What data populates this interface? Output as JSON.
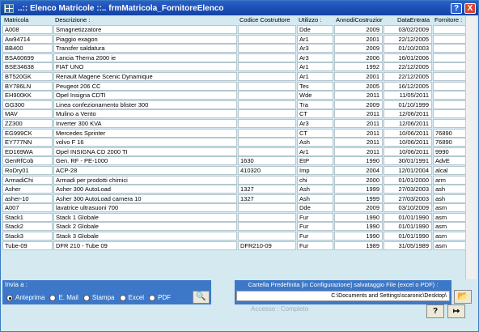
{
  "window": {
    "title": "..:: Elenco Matricole ::..   frmMatricola_FornitoreElenco",
    "help_glyph": "?",
    "close_glyph": "X"
  },
  "columns": [
    "Matricola",
    "Descrizione :",
    "Codice Costruttore",
    "Utilizzo :",
    "AnnodiCostruzione",
    "DataEntrata",
    "Fornitore :"
  ],
  "rows": [
    [
      "A008",
      "Smagnetizzatore",
      "",
      "Dde",
      "2009",
      "03/02/2009",
      ""
    ],
    [
      "Aw94714",
      "Piaggio exagon",
      "",
      "Ar1",
      "2001",
      "22/12/2005",
      ""
    ],
    [
      "BB400",
      "Transfer saldatura",
      "",
      "Ar3",
      "2009",
      "01/10/2003",
      ""
    ],
    [
      "BSA60699",
      "Lancia Thema 2000 ie",
      "",
      "Ar3",
      "2006",
      "16/01/2006",
      ""
    ],
    [
      "BSE34638",
      "FIAT UNO",
      "",
      "Ar1",
      "1992",
      "22/12/2005",
      ""
    ],
    [
      "BT520GK",
      "Renault Magene Scenic Dynamique",
      "",
      "Ar1",
      "2001",
      "22/12/2005",
      ""
    ],
    [
      "BY786LN",
      "Peugeot 206 CC",
      "",
      "Tes",
      "2005",
      "16/12/2005",
      ""
    ],
    [
      "EH900KK",
      "Opel Insigna CDTI",
      "",
      "Wde",
      "2011",
      "11/05/2011",
      ""
    ],
    [
      "GG300",
      "Linea confezionamento blister 300",
      "",
      "Tra",
      "2009",
      "01/10/1999",
      ""
    ],
    [
      "MAV",
      "Mulino a Vento",
      "",
      "CT",
      "2011",
      "12/06/2011",
      ""
    ],
    [
      "ZZ300",
      "Inverter  300 KVA",
      "",
      "Ar3",
      "2011",
      "12/06/2011",
      ""
    ],
    [
      "EG999CK",
      "Mercedes Sprinter",
      "",
      "CT",
      "2011",
      "10/06/2011",
      "76890"
    ],
    [
      "EY777NN",
      "volvo F 16",
      "",
      "Ash",
      "2011",
      "10/06/2011",
      "76890"
    ],
    [
      "ED169WA",
      "Opel INSIGNA CD 2000 TI",
      "",
      "Ar1",
      "2011",
      "10/06/2011",
      "9990"
    ],
    [
      "GenRfCob",
      "Gen. RF - PE-1000",
      "1630",
      "EtP",
      "1990",
      "30/01/1991",
      "AdvE"
    ],
    [
      "RoDry01",
      "ACP-28",
      "410320",
      "Imp",
      "2004",
      "12/01/2004",
      "alcal"
    ],
    [
      "ArmadiChi",
      "Armadi per prodotti chimici",
      "",
      "chi",
      "2000",
      "01/01/2000",
      "arm"
    ],
    [
      "Asher",
      "Asher 300 AutoLoad",
      "1327",
      "Ash",
      "1999",
      "27/03/2003",
      "ash"
    ],
    [
      "asher-10",
      "Asher 300 AutoLoad camera 10",
      "1327",
      "Ash",
      "1999",
      "27/03/2003",
      "ash"
    ],
    [
      "A007",
      "lavatrice ultrasuoni  700",
      "",
      "Dde",
      "2009",
      "03/10/2009",
      "asm"
    ],
    [
      "Stack1",
      "Stack 1 Globale",
      "",
      "Fur",
      "1990",
      "01/01/1990",
      "asm"
    ],
    [
      "Stack2",
      "Stack 2 Globale",
      "",
      "Fur",
      "1990",
      "01/01/1990",
      "asm"
    ],
    [
      "Stack3",
      "Stack 3 Globale",
      "",
      "Fur",
      "1990",
      "01/01/1990",
      "asm"
    ],
    [
      "Tube-09",
      "DFR 210 - Tube 09",
      "DFR210-09",
      "Fur",
      "1989",
      "31/05/1989",
      "asm"
    ]
  ],
  "invia": {
    "label": "Invia a :",
    "options": [
      "Anteprima",
      "E. Mail",
      "Stampa",
      "Excel",
      "PDF"
    ],
    "selected": "Anteprima"
  },
  "cartella": {
    "label": "Cartella Predefinita  [in Configurazione] salvataggio File (excel o PDF) :",
    "path": "C:\\Documents and Settings\\scaronic\\Desktop\\"
  },
  "status": {
    "accesso": "Accesso : Completo"
  },
  "icons": {
    "preview": "magnifier-icon",
    "folder": "open-folder-icon",
    "help": "help-icon",
    "exit": "exit-door-icon"
  }
}
